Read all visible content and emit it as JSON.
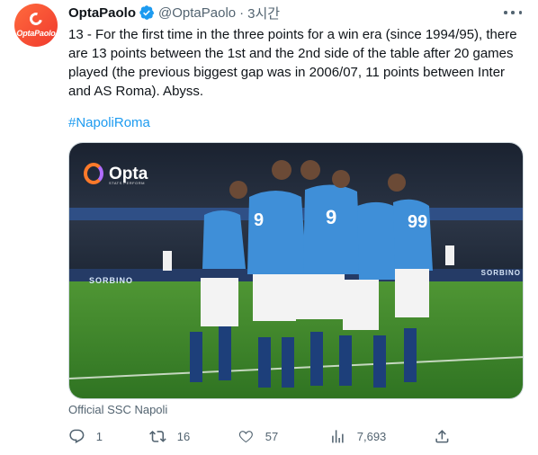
{
  "author": {
    "display_name": "OptaPaolo",
    "handle": "@OptaPaolo",
    "separator": "·",
    "time_ago": "3시간",
    "avatar_text": "OptaPaolo",
    "verified": true
  },
  "tweet": {
    "text": "13 - For the first time in the three points for a win era (since 1994/95), there are 13 points between the 1st and the 2nd side of the table after 20 games played (the previous biggest gap was in 2006/07, 11 points between Inter and AS Roma). Abyss.",
    "hashtag": "#NapoliRoma"
  },
  "media": {
    "logo_text": "Opta",
    "logo_subtext": "STATS PERFORM",
    "board_text": "SORBINO",
    "caption": "Official SSC Napoli"
  },
  "metrics": {
    "replies": "1",
    "retweets": "16",
    "likes": "57",
    "views": "7,693"
  },
  "colors": {
    "accent": "#1d9bf0",
    "secondary_text": "#536471",
    "napoli_blue": "#3f8fd8",
    "pitch_green": "#3f8a2a"
  }
}
